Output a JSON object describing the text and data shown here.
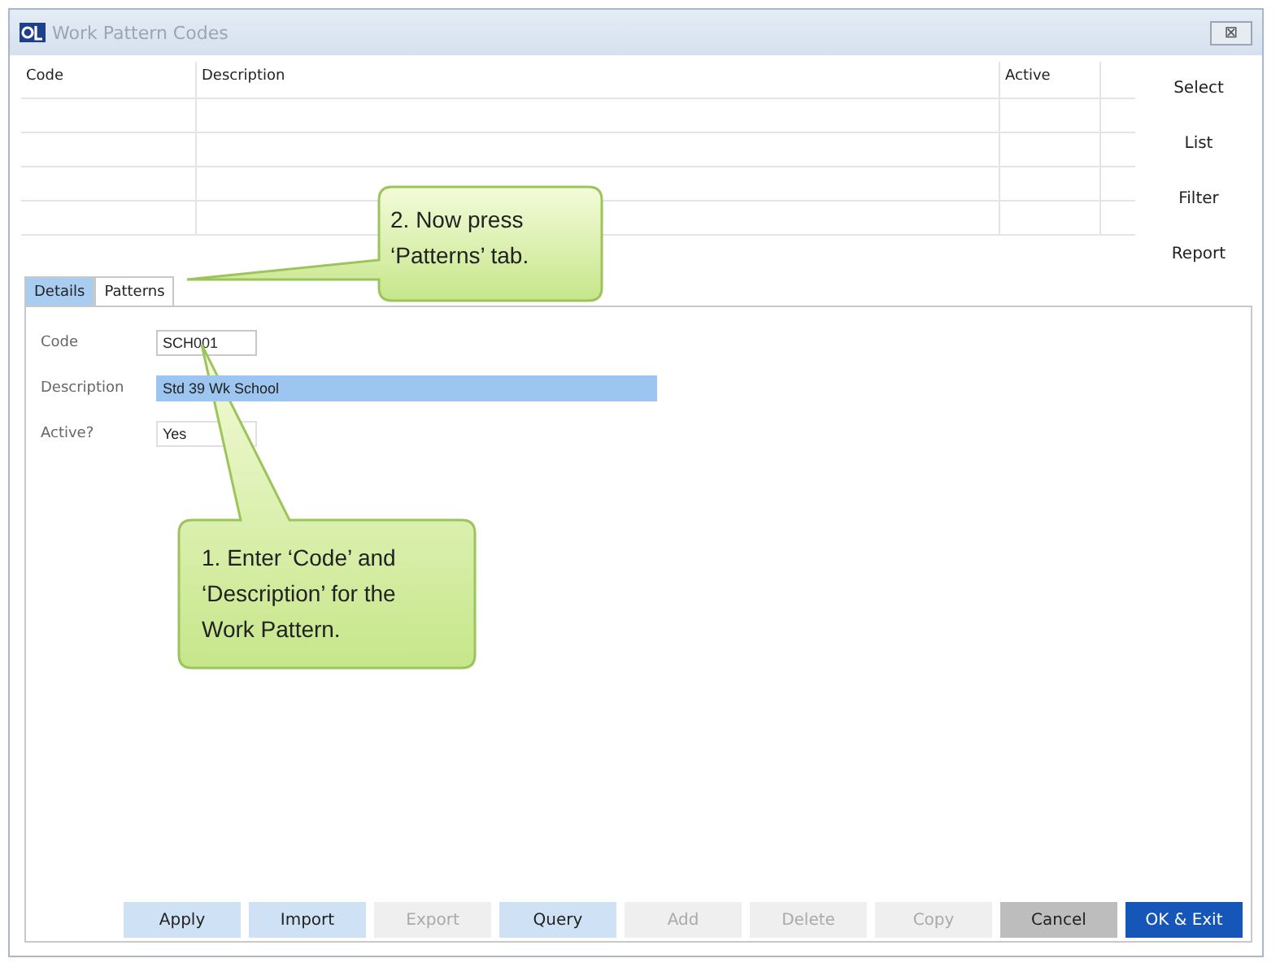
{
  "window": {
    "title": "Work Pattern Codes",
    "close": "⊠"
  },
  "grid": {
    "columns": [
      "Code",
      "Description",
      "Active"
    ]
  },
  "side_buttons": [
    "Select",
    "List",
    "Filter",
    "Report"
  ],
  "tabs": [
    {
      "label": "Details",
      "selected": true
    },
    {
      "label": "Patterns",
      "selected": false
    }
  ],
  "form": {
    "fields": [
      {
        "kind": "text",
        "label": "Code",
        "value": "SCH001",
        "selected": false
      },
      {
        "kind": "text",
        "label": "Description",
        "value": "Std 39 Wk School",
        "selected": true
      },
      {
        "kind": "select",
        "label": "Active?",
        "value": "Yes",
        "selected": false
      }
    ]
  },
  "buttons": [
    {
      "label": "Apply",
      "kind": "default",
      "disabled": false
    },
    {
      "label": "Import",
      "kind": "default",
      "disabled": false
    },
    {
      "label": "Export",
      "kind": "default",
      "disabled": true
    },
    {
      "label": "Query",
      "kind": "default",
      "disabled": false
    },
    {
      "label": "Add",
      "kind": "default",
      "disabled": true
    },
    {
      "label": "Delete",
      "kind": "default",
      "disabled": true
    },
    {
      "label": "Copy",
      "kind": "default",
      "disabled": true
    },
    {
      "label": "Cancel",
      "kind": "cancel",
      "disabled": false
    },
    {
      "label": "OK & Exit",
      "kind": "primary",
      "disabled": false
    }
  ],
  "callouts": [
    {
      "text": "2. Now press ‘Patterns’ tab."
    },
    {
      "text": "1. Enter ‘Code’ and ‘Description’ for the Work Pattern."
    }
  ]
}
